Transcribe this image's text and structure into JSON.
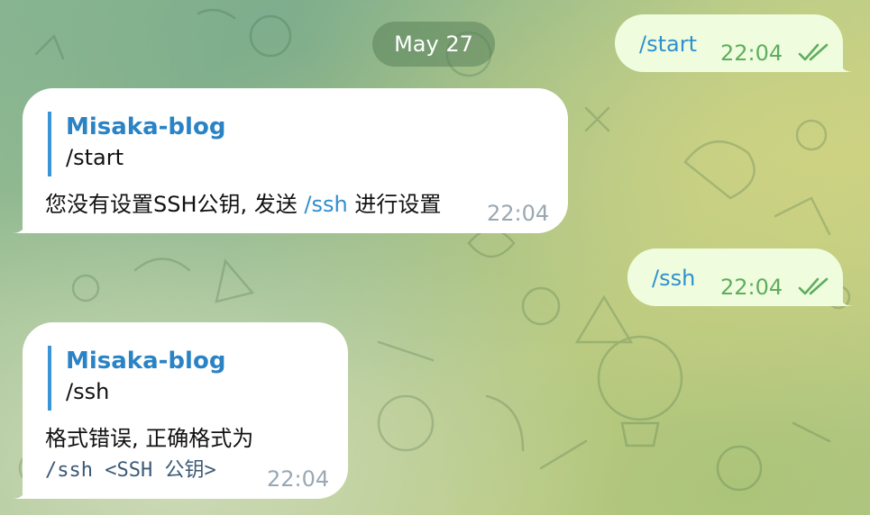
{
  "date_separator": "May 27",
  "colors": {
    "outgoing_bubble": "#effdde",
    "incoming_bubble": "#ffffff",
    "link": "#2f8fcf",
    "reply_name": "#2a83c4",
    "outgoing_time": "#5fad5e",
    "incoming_time": "#9aa8b3"
  },
  "messages": [
    {
      "direction": "outgoing",
      "text": "/start",
      "time": "22:04",
      "status_icon": "double-check-icon"
    },
    {
      "direction": "incoming",
      "reply_to": {
        "name": "Misaka-blog",
        "text": "/start"
      },
      "text_before": "您没有设置SSH公钥, 发送 ",
      "link": "/ssh",
      "text_after": " 进行设置",
      "time": "22:04"
    },
    {
      "direction": "outgoing",
      "text": "/ssh",
      "time": "22:04",
      "status_icon": "double-check-icon"
    },
    {
      "direction": "incoming",
      "reply_to": {
        "name": "Misaka-blog",
        "text": "/ssh"
      },
      "text": "格式错误, 正确格式为",
      "code": "/ssh <SSH 公钥>",
      "time": "22:04"
    }
  ]
}
